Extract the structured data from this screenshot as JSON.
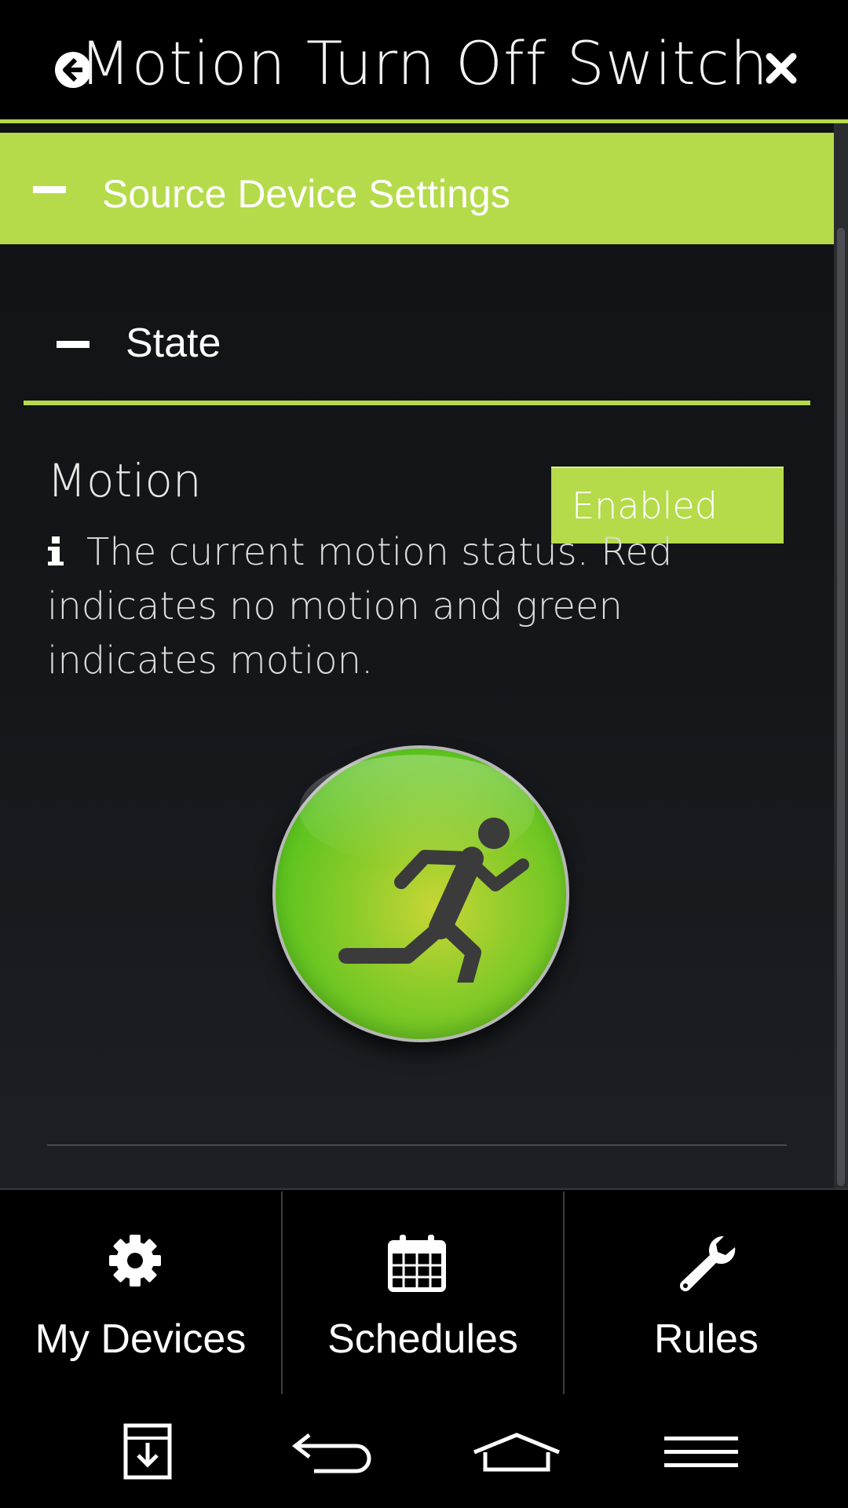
{
  "header": {
    "title": "Motion Turn Off Switch",
    "back_icon": "arrow-left-circle-icon",
    "close_icon": "close-x-icon"
  },
  "section": {
    "label": "Source Device Settings",
    "toggle_icon": "minus-icon"
  },
  "subsection": {
    "label": "State",
    "toggle_icon": "minus-icon"
  },
  "motion": {
    "label": "Motion",
    "status_button": "Enabled",
    "description": "The current motion status. Red indicates no motion and green indicates motion.",
    "info_icon": "info-icon",
    "indicator_icon": "running-person-icon",
    "indicator_state": "motion"
  },
  "tabs": [
    {
      "label": "My Devices",
      "icon": "gear-icon"
    },
    {
      "label": "Schedules",
      "icon": "calendar-icon"
    },
    {
      "label": "Rules",
      "icon": "wrench-icon"
    }
  ],
  "navbar": {
    "icons": [
      "download-icon",
      "back-icon",
      "home-icon",
      "menu-icon"
    ]
  },
  "colors": {
    "accent": "#b5db4a",
    "indicator": "#5cc31f",
    "background": "#000000"
  }
}
